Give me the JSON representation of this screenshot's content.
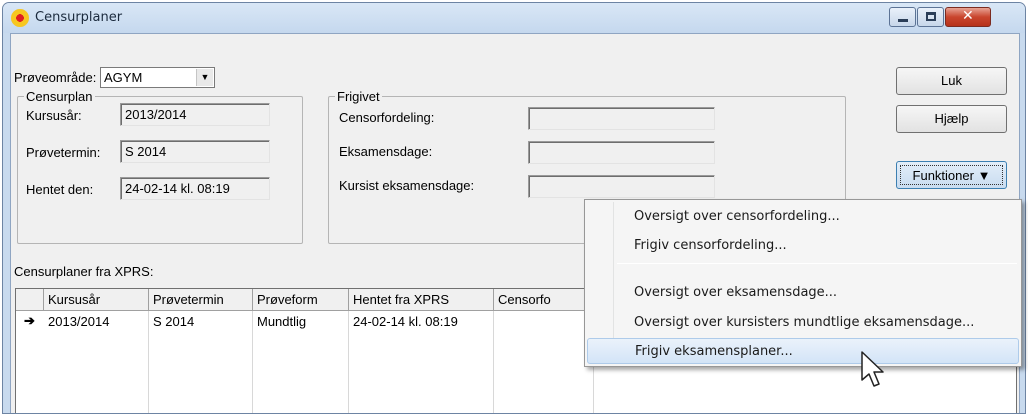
{
  "window": {
    "title": "Censurplaner",
    "icon": "flower-icon"
  },
  "proveomrade": {
    "label": "Prøveområde:",
    "value": "AGYM"
  },
  "censurplan": {
    "legend": "Censurplan",
    "kursusaar_label": "Kursusår:",
    "kursusaar_value": "2013/2014",
    "provetermin_label": "Prøvetermin:",
    "provetermin_value": "S 2014",
    "hentet_label": "Hentet den:",
    "hentet_value": "24-02-14 kl. 08:19"
  },
  "frigivet": {
    "legend": "Frigivet",
    "censorfordeling_label": "Censorfordeling:",
    "censorfordeling_value": "",
    "eksamensdage_label": "Eksamensdage:",
    "eksamensdage_value": "",
    "kursist_label": "Kursist eksamensdage:",
    "kursist_value": ""
  },
  "buttons": {
    "luk": "Luk",
    "hjaelp": "Hjælp",
    "funktioner": "Funktioner"
  },
  "table": {
    "caption": "Censurplaner fra XPRS:",
    "columns": [
      "Kursusår",
      "Prøvetermin",
      "Prøveform",
      "Hentet fra XPRS",
      "Censorfo"
    ],
    "rows": [
      {
        "indicator": "➔",
        "cells": [
          "2013/2014",
          "S 2014",
          "Mundtlig",
          "24-02-14 kl. 08:19",
          ""
        ]
      }
    ]
  },
  "menu": {
    "items": [
      "Oversigt over censorfordeling...",
      "Frigiv censorfordeling...",
      "Oversigt over eksamensdage...",
      "Oversigt over kursisters mundtlige eksamensdage...",
      "Frigiv eksamensplaner..."
    ],
    "highlighted_index": 4
  }
}
